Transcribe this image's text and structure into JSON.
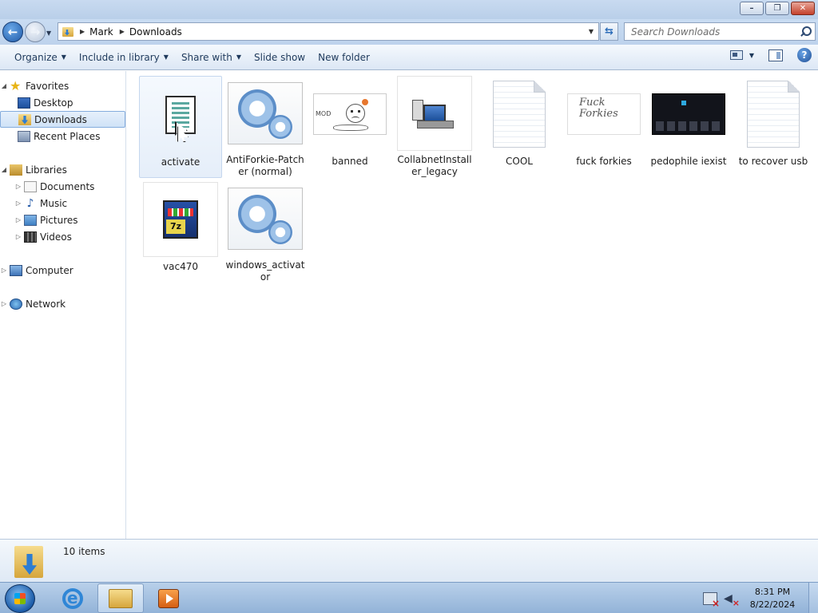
{
  "window": {
    "minimize_glyph": "–",
    "maximize_glyph": "❐",
    "close_glyph": "✕"
  },
  "address": {
    "breadcrumbs": [
      "Mark",
      "Downloads"
    ],
    "search_placeholder": "Search Downloads"
  },
  "toolbar": {
    "organize": "Organize",
    "include_in_library": "Include in library",
    "share_with": "Share with",
    "slide_show": "Slide show",
    "new_folder": "New folder",
    "help": "?"
  },
  "nav": {
    "favorites": "Favorites",
    "desktop": "Desktop",
    "downloads": "Downloads",
    "recent_places": "Recent Places",
    "libraries": "Libraries",
    "documents": "Documents",
    "music": "Music",
    "pictures": "Pictures",
    "videos": "Videos",
    "computer": "Computer",
    "network": "Network"
  },
  "files": [
    {
      "name": "activate",
      "kind": "script-icon"
    },
    {
      "name": "AntiForkie-Patcher (normal)",
      "kind": "gear-icon"
    },
    {
      "name": "banned",
      "kind": "image-thumbnail"
    },
    {
      "name": "CollabnetInstaller_legacy",
      "kind": "installer-icon"
    },
    {
      "name": "COOL",
      "kind": "document-icon"
    },
    {
      "name": "fuck forkies",
      "kind": "image-thumbnail"
    },
    {
      "name": "pedophile iexist",
      "kind": "image-thumbnail"
    },
    {
      "name": "to recover usb",
      "kind": "document-icon"
    },
    {
      "name": "vac470",
      "kind": "archive-icon"
    },
    {
      "name": "windows_activator",
      "kind": "gear-icon"
    }
  ],
  "thumb_text": {
    "banned_scribble": "MOD",
    "fuck_forkies_line1": "Fuck",
    "fuck_forkies_line2": "Forkies"
  },
  "details": {
    "item_count": "10 items"
  },
  "taskbar": {
    "time": "8:31 PM",
    "date": "8/22/2024"
  }
}
